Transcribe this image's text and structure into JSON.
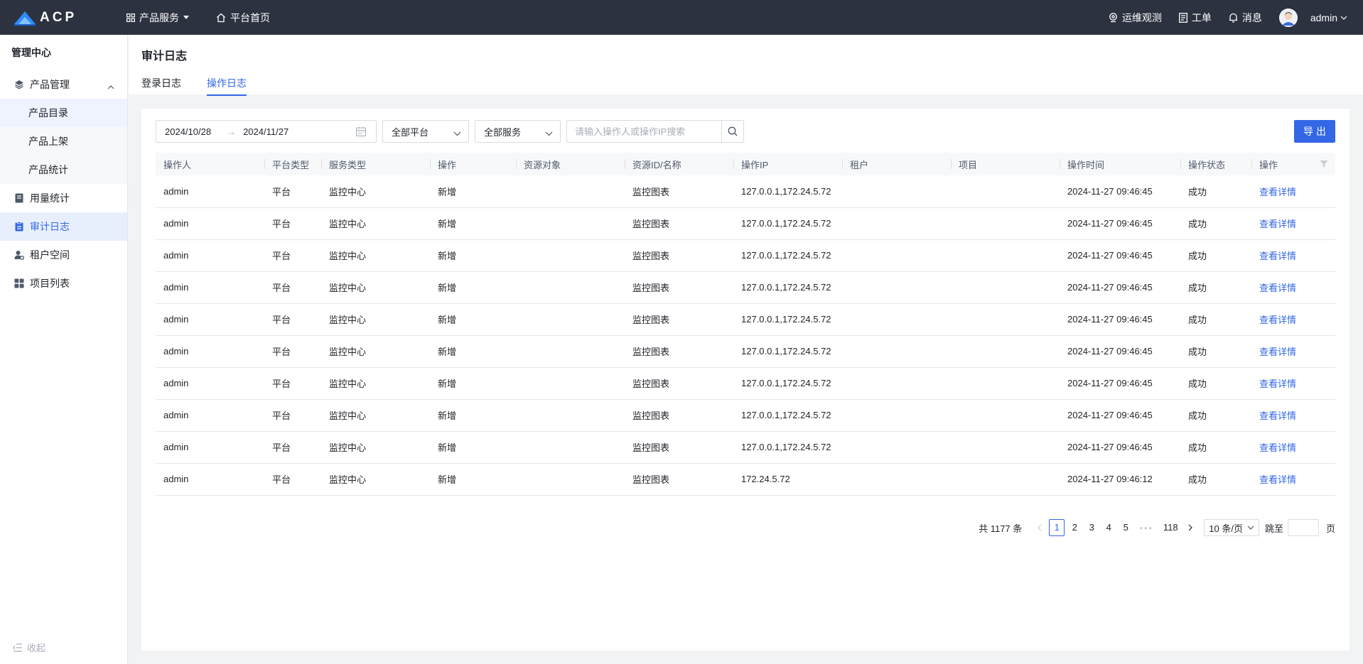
{
  "topbar": {
    "logo_text": "ACP",
    "nav": [
      {
        "label": "产品服务",
        "icon": "grid-icon"
      },
      {
        "label": "平台首页",
        "icon": "home-icon"
      }
    ],
    "right": {
      "monitor_label": "运维观测",
      "ticket_label": "工单",
      "message_label": "消息",
      "user_name": "admin"
    }
  },
  "sidebar": {
    "title": "管理中心",
    "product_mgmt": "产品管理",
    "sub_items": [
      "产品目录",
      "产品上架",
      "产品统计"
    ],
    "usage": "用量统计",
    "audit": "审计日志",
    "tenant": "租户空间",
    "projects": "项目列表",
    "collapse": "收起"
  },
  "header": {
    "title": "审计日志",
    "tabs": [
      "登录日志",
      "操作日志"
    ],
    "active_tab": "操作日志"
  },
  "filters": {
    "date_start": "2024/10/28",
    "date_end": "2024/11/27",
    "arrow": "→",
    "platform": "全部平台",
    "service": "全部服务",
    "search_placeholder": "请输入操作人或操作IP搜索",
    "export_label": "导出"
  },
  "table": {
    "columns": [
      "操作人",
      "平台类型",
      "服务类型",
      "操作",
      "资源对象",
      "资源ID/名称",
      "操作IP",
      "租户",
      "项目",
      "操作时间",
      "操作状态",
      "操作"
    ],
    "rows": [
      [
        "admin",
        "平台",
        "监控中心",
        "新增",
        "",
        "监控图表",
        "127.0.0.1,172.24.5.72",
        "",
        "",
        "2024-11-27 09:46:45",
        "成功",
        "查看详情"
      ],
      [
        "admin",
        "平台",
        "监控中心",
        "新增",
        "",
        "监控图表",
        "127.0.0.1,172.24.5.72",
        "",
        "",
        "2024-11-27 09:46:45",
        "成功",
        "查看详情"
      ],
      [
        "admin",
        "平台",
        "监控中心",
        "新增",
        "",
        "监控图表",
        "127.0.0.1,172.24.5.72",
        "",
        "",
        "2024-11-27 09:46:45",
        "成功",
        "查看详情"
      ],
      [
        "admin",
        "平台",
        "监控中心",
        "新增",
        "",
        "监控图表",
        "127.0.0.1,172.24.5.72",
        "",
        "",
        "2024-11-27 09:46:45",
        "成功",
        "查看详情"
      ],
      [
        "admin",
        "平台",
        "监控中心",
        "新增",
        "",
        "监控图表",
        "127.0.0.1,172.24.5.72",
        "",
        "",
        "2024-11-27 09:46:45",
        "成功",
        "查看详情"
      ],
      [
        "admin",
        "平台",
        "监控中心",
        "新增",
        "",
        "监控图表",
        "127.0.0.1,172.24.5.72",
        "",
        "",
        "2024-11-27 09:46:45",
        "成功",
        "查看详情"
      ],
      [
        "admin",
        "平台",
        "监控中心",
        "新增",
        "",
        "监控图表",
        "127.0.0.1,172.24.5.72",
        "",
        "",
        "2024-11-27 09:46:45",
        "成功",
        "查看详情"
      ],
      [
        "admin",
        "平台",
        "监控中心",
        "新增",
        "",
        "监控图表",
        "127.0.0.1,172.24.5.72",
        "",
        "",
        "2024-11-27 09:46:45",
        "成功",
        "查看详情"
      ],
      [
        "admin",
        "平台",
        "监控中心",
        "新增",
        "",
        "监控图表",
        "127.0.0.1,172.24.5.72",
        "",
        "",
        "2024-11-27 09:46:45",
        "成功",
        "查看详情"
      ],
      [
        "admin",
        "平台",
        "监控中心",
        "新增",
        "",
        "监控图表",
        "172.24.5.72",
        "",
        "",
        "2024-11-27 09:46:12",
        "成功",
        "查看详情"
      ]
    ]
  },
  "pagination": {
    "total": "共 1177 条",
    "pages": [
      "1",
      "2",
      "3",
      "4",
      "5"
    ],
    "current": "1",
    "last": "118",
    "page_size": "10 条/页",
    "jump_label": "跳至",
    "jump_unit": "页"
  },
  "colors": {
    "topbar": "#2d3241",
    "primary": "#3367e6"
  }
}
